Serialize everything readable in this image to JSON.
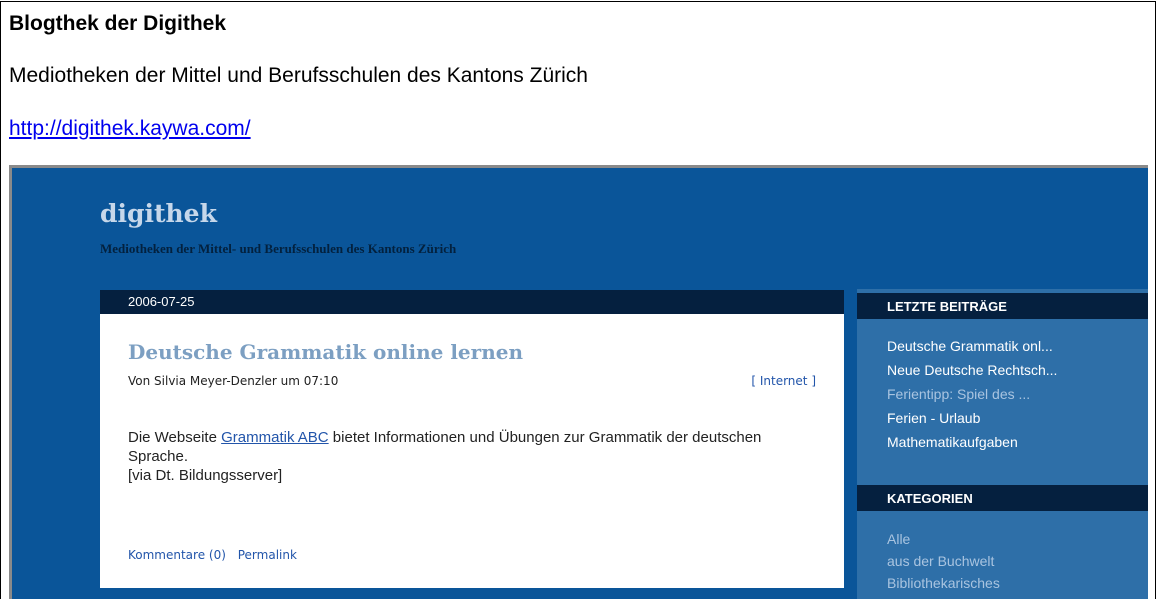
{
  "document": {
    "title": "Blogthek der Digithek",
    "subtitle": "Mediotheken der Mittel und Berufsschulen des Kantons Zürich",
    "url": "http://digithek.kaywa.com/"
  },
  "blog": {
    "name": "digithek",
    "tagline": "Mediotheken der Mittel- und Berufsschulen des Kantons Zürich"
  },
  "post": {
    "date": "2006-07-25",
    "title": "Deutsche Grammatik online lernen",
    "meta": "Von Silvia Meyer-Denzler um 07:10",
    "category": "[ Internet ]",
    "body_before_link": "Die Webseite ",
    "link_text": "Grammatik ABC",
    "body_after_link": " bietet Informationen und Übungen zur Grammatik der deutschen Sprache.",
    "via": "[via Dt. Bildungsserver]",
    "comments": "Kommentare (0)",
    "permalink": "Permalink"
  },
  "sidebar": {
    "recent_heading": "LETZTE BEITRÄGE",
    "recent": [
      "Deutsche Grammatik onl...",
      "Neue Deutsche Rechtsch...",
      "Ferientipp: Spiel des ...",
      "Ferien - Urlaub",
      "Mathematikaufgaben"
    ],
    "categories_heading": "KATEGORIEN",
    "categories": [
      "Alle",
      "aus der Buchwelt",
      "Bibliothekarisches"
    ]
  },
  "colors": {
    "page_bg": "#0a5599",
    "bar_dark": "#05203f",
    "sidebar_bg": "#2e6fa8",
    "link": "#2255aa"
  }
}
